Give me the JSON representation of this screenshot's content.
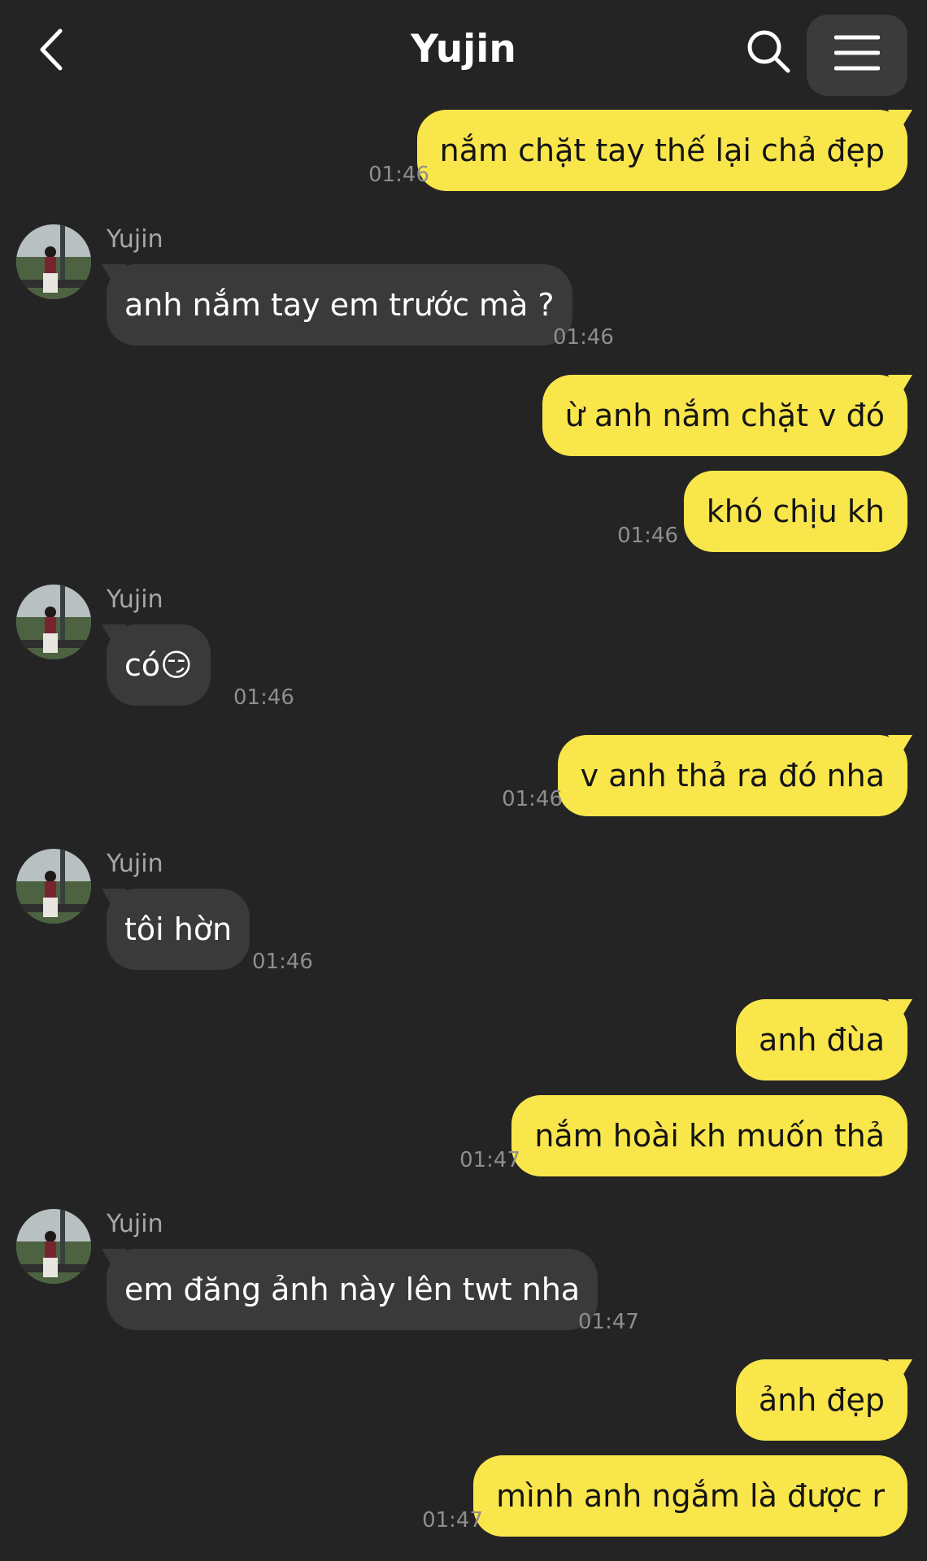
{
  "header": {
    "title": "Yujin"
  },
  "icons": {
    "back": "chevron-left-icon",
    "search": "search-icon",
    "menu": "hamburger-menu-icon"
  },
  "colors": {
    "background": "#242424",
    "outgoing_bubble": "#f9e64b",
    "incoming_bubble": "#3a3a3a",
    "timestamp": "#8e8e8e"
  },
  "messages": [
    {
      "dir": "out",
      "text": "nắm chặt tay thế lại chả đẹp",
      "time": "01:46"
    },
    {
      "dir": "in",
      "sender": "Yujin",
      "text": "anh nắm tay em trước mà ?",
      "time": "01:46"
    },
    {
      "dir": "out",
      "text": "ừ anh nắm chặt v đó",
      "time": ""
    },
    {
      "dir": "out",
      "text": "khó chịu kh",
      "time": "01:46"
    },
    {
      "dir": "in",
      "sender": "Yujin",
      "text": "có😏",
      "time": "01:46"
    },
    {
      "dir": "out",
      "text": "v anh thả ra đó nha",
      "time": "01:46"
    },
    {
      "dir": "in",
      "sender": "Yujin",
      "text": "tôi hờn",
      "time": "01:46"
    },
    {
      "dir": "out",
      "text": "anh đùa",
      "time": ""
    },
    {
      "dir": "out",
      "text": "nắm hoài kh muốn thả",
      "time": "01:47"
    },
    {
      "dir": "in",
      "sender": "Yujin",
      "text": "em đăng ảnh này lên twt nha",
      "time": "01:47"
    },
    {
      "dir": "out",
      "text": "ảnh đẹp",
      "time": ""
    },
    {
      "dir": "out",
      "text": "mình anh ngắm là được r",
      "time": "01:47"
    }
  ]
}
